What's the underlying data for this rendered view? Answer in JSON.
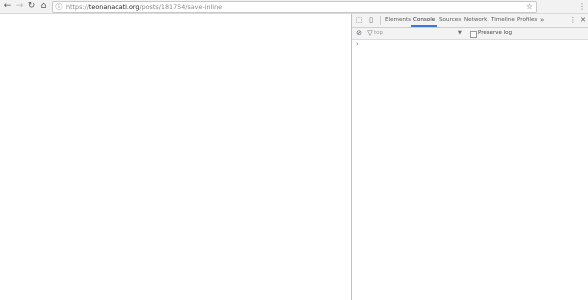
{
  "browser": {
    "back_icon": "arrow-left-icon",
    "forward_icon": "arrow-right-icon",
    "reload_icon": "reload-icon",
    "home_icon": "home-icon",
    "url_scheme": "https://",
    "url_host": "teonanacatl.org",
    "url_path": "/posts/181754/save-inline",
    "bookmark_icon": "star-icon",
    "menu_icon": "menu-dots-icon"
  },
  "devtools": {
    "tabs": [
      "Elements",
      "Console",
      "Sources",
      "Network",
      "Timeline",
      "Profiles"
    ],
    "active_tab": "Console",
    "more_tabs": "»",
    "filter_placeholder": "top",
    "preserve_log_label": "Preserve log",
    "prompt": "›",
    "accent_color": "#3879d9"
  }
}
